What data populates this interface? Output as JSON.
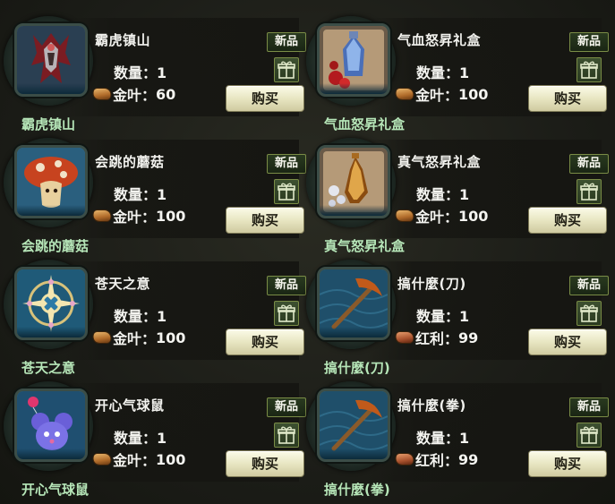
{
  "labels": {
    "new_badge": "新品",
    "buy_button": "购买",
    "qty_prefix": "数量："
  },
  "items": [
    {
      "name": "霸虎镇山",
      "quantity": "1",
      "currency": "金叶：",
      "price": "60",
      "caption": "霸虎镇山",
      "icon": "armor-icon",
      "leaf": "gold"
    },
    {
      "name": "气血怒昇礼盒",
      "quantity": "1",
      "currency": "金叶：",
      "price": "100",
      "caption": "气血怒昇礼盒",
      "icon": "potion-box-icon",
      "leaf": "gold"
    },
    {
      "name": "会跳的蘑菇",
      "quantity": "1",
      "currency": "金叶：",
      "price": "100",
      "caption": "会跳的蘑菇",
      "icon": "mushroom-icon",
      "leaf": "gold"
    },
    {
      "name": "真气怒昇礼盒",
      "quantity": "1",
      "currency": "金叶：",
      "price": "100",
      "caption": "真气怒昇礼盒",
      "icon": "vase-pearls-icon",
      "leaf": "gold"
    },
    {
      "name": "苍天之意",
      "quantity": "1",
      "currency": "金叶：",
      "price": "100",
      "caption": "苍天之意",
      "icon": "compass-emblem-icon",
      "leaf": "gold"
    },
    {
      "name": "搞什麼(刀)",
      "quantity": "1",
      "currency": "红利：",
      "price": "99",
      "caption": "搞什麼(刀)",
      "icon": "pickaxe-icon",
      "leaf": "red"
    },
    {
      "name": "开心气球鼠",
      "quantity": "1",
      "currency": "金叶：",
      "price": "100",
      "caption": "开心气球鼠",
      "icon": "balloon-mouse-icon",
      "leaf": "gold"
    },
    {
      "name": "搞什麼(拳)",
      "quantity": "1",
      "currency": "红利：",
      "price": "99",
      "caption": "搞什麼(拳)",
      "icon": "pickaxe-icon",
      "leaf": "red"
    }
  ]
}
